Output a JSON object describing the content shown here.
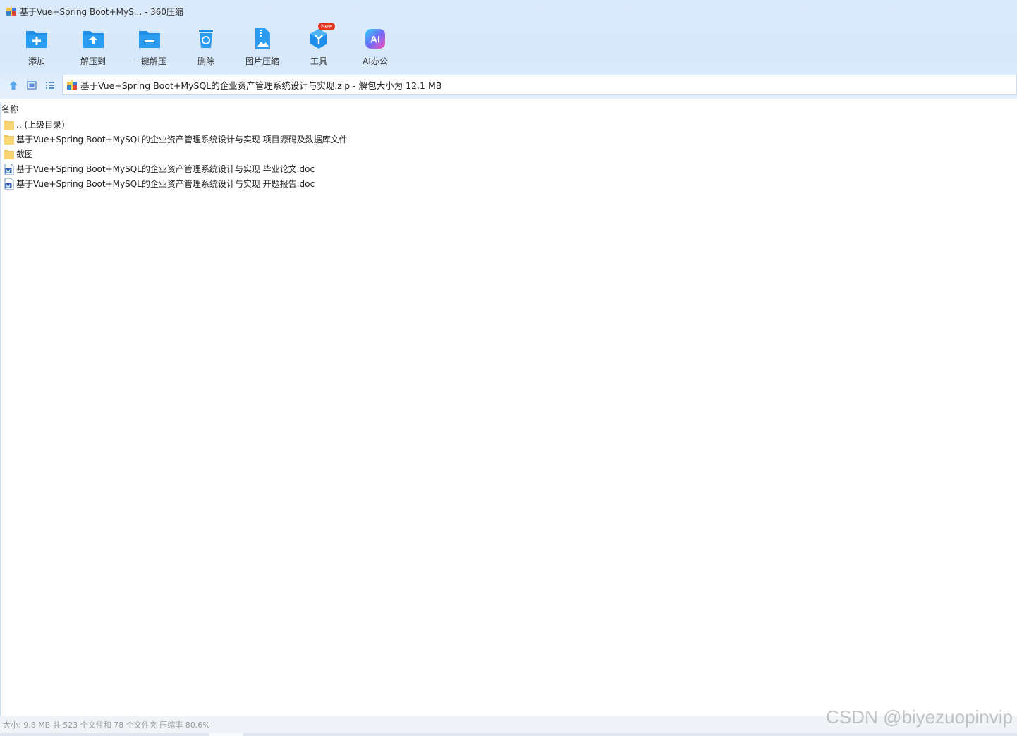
{
  "window": {
    "title": "基于Vue+Spring Boot+MyS... - 360压缩"
  },
  "toolbar": {
    "items": [
      {
        "label": "添加",
        "icon": "add-folder-icon"
      },
      {
        "label": "解压到",
        "icon": "extract-to-icon"
      },
      {
        "label": "一键解压",
        "icon": "one-click-extract-icon"
      },
      {
        "label": "删除",
        "icon": "delete-icon"
      },
      {
        "label": "图片压缩",
        "icon": "image-compress-icon"
      },
      {
        "label": "工具",
        "icon": "tools-icon",
        "badge": "New"
      },
      {
        "label": "AI办公",
        "icon": "ai-office-icon",
        "glyph": "AI"
      }
    ]
  },
  "address": {
    "path": "基于Vue+Spring Boot+MySQL的企业资产管理系统设计与实现.zip - 解包大小为 12.1 MB"
  },
  "list": {
    "column_name": "名称",
    "rows": [
      {
        "name": ".. (上级目录)",
        "type": "folder"
      },
      {
        "name": "基于Vue+Spring Boot+MySQL的企业资产管理系统设计与实现 项目源码及数据库文件",
        "type": "folder"
      },
      {
        "name": "截图",
        "type": "folder"
      },
      {
        "name": "基于Vue+Spring Boot+MySQL的企业资产管理系统设计与实现 毕业论文.doc",
        "type": "doc"
      },
      {
        "name": "基于Vue+Spring Boot+MySQL的企业资产管理系统设计与实现 开题报告.doc",
        "type": "doc"
      }
    ]
  },
  "status": {
    "text": "大小: 9.8 MB 共 523 个文件和 78 个文件夹 压缩率 80.6%"
  },
  "watermark": "CSDN @biyezuopinvip",
  "colors": {
    "accent_blue": "#1e8ee8",
    "folder_yellow": "#f8d676",
    "badge_red": "#e8341c"
  }
}
